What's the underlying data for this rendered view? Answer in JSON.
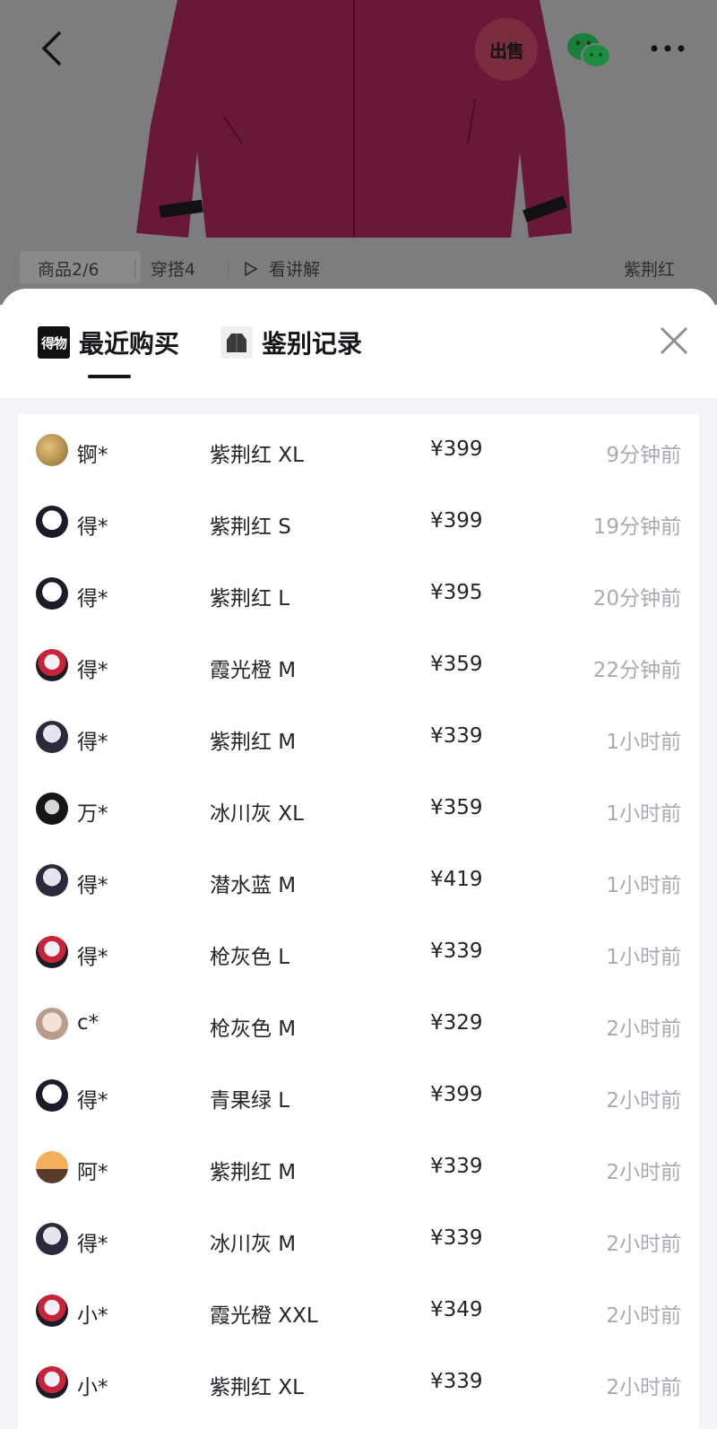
{
  "header": {
    "sell_label": "出售",
    "product_index": "商品2/6",
    "outfits": "穿搭4",
    "explain": "看讲解",
    "color_name": "紫荆红"
  },
  "sheet": {
    "logo_text": "得物",
    "tabs": [
      {
        "label": "最近购买"
      },
      {
        "label": "鉴别记录"
      }
    ]
  },
  "colors": {
    "jacket": "#8b1a4a",
    "overlay": "#7d7d80",
    "time_gray": "#a9a9b1"
  },
  "rows": [
    {
      "buyer": "锕*",
      "spec": "紫荆红 XL",
      "price": "¥399",
      "time": "9分钟前",
      "avatar": "avatar-gold"
    },
    {
      "buyer": "得*",
      "spec": "紫荆红 S",
      "price": "¥399",
      "time": "19分钟前",
      "avatar": "avatar-panda"
    },
    {
      "buyer": "得*",
      "spec": "紫荆红 L",
      "price": "¥395",
      "time": "20分钟前",
      "avatar": "avatar-panda"
    },
    {
      "buyer": "得*",
      "spec": "霞光橙 M",
      "price": "¥359",
      "time": "22分钟前",
      "avatar": "avatar-red"
    },
    {
      "buyer": "得*",
      "spec": "紫荆红 M",
      "price": "¥339",
      "time": "1小时前",
      "avatar": "avatar-helmet"
    },
    {
      "buyer": "万*",
      "spec": "冰川灰 XL",
      "price": "¥359",
      "time": "1小时前",
      "avatar": "avatar-dark"
    },
    {
      "buyer": "得*",
      "spec": "潜水蓝 M",
      "price": "¥419",
      "time": "1小时前",
      "avatar": "avatar-helmet"
    },
    {
      "buyer": "得*",
      "spec": "枪灰色 L",
      "price": "¥339",
      "time": "1小时前",
      "avatar": "avatar-red"
    },
    {
      "buyer": "c*",
      "spec": "枪灰色 M",
      "price": "¥329",
      "time": "2小时前",
      "avatar": "avatar-girl"
    },
    {
      "buyer": "得*",
      "spec": "青果绿 L",
      "price": "¥399",
      "time": "2小时前",
      "avatar": "avatar-panda"
    },
    {
      "buyer": "阿*",
      "spec": "紫荆红 M",
      "price": "¥339",
      "time": "2小时前",
      "avatar": "avatar-sunset"
    },
    {
      "buyer": "得*",
      "spec": "冰川灰 M",
      "price": "¥339",
      "time": "2小时前",
      "avatar": "avatar-helmet"
    },
    {
      "buyer": "小*",
      "spec": "霞光橙 XXL",
      "price": "¥349",
      "time": "2小时前",
      "avatar": "avatar-red"
    },
    {
      "buyer": "小*",
      "spec": "紫荆红 XL",
      "price": "¥339",
      "time": "2小时前",
      "avatar": "avatar-red"
    }
  ]
}
